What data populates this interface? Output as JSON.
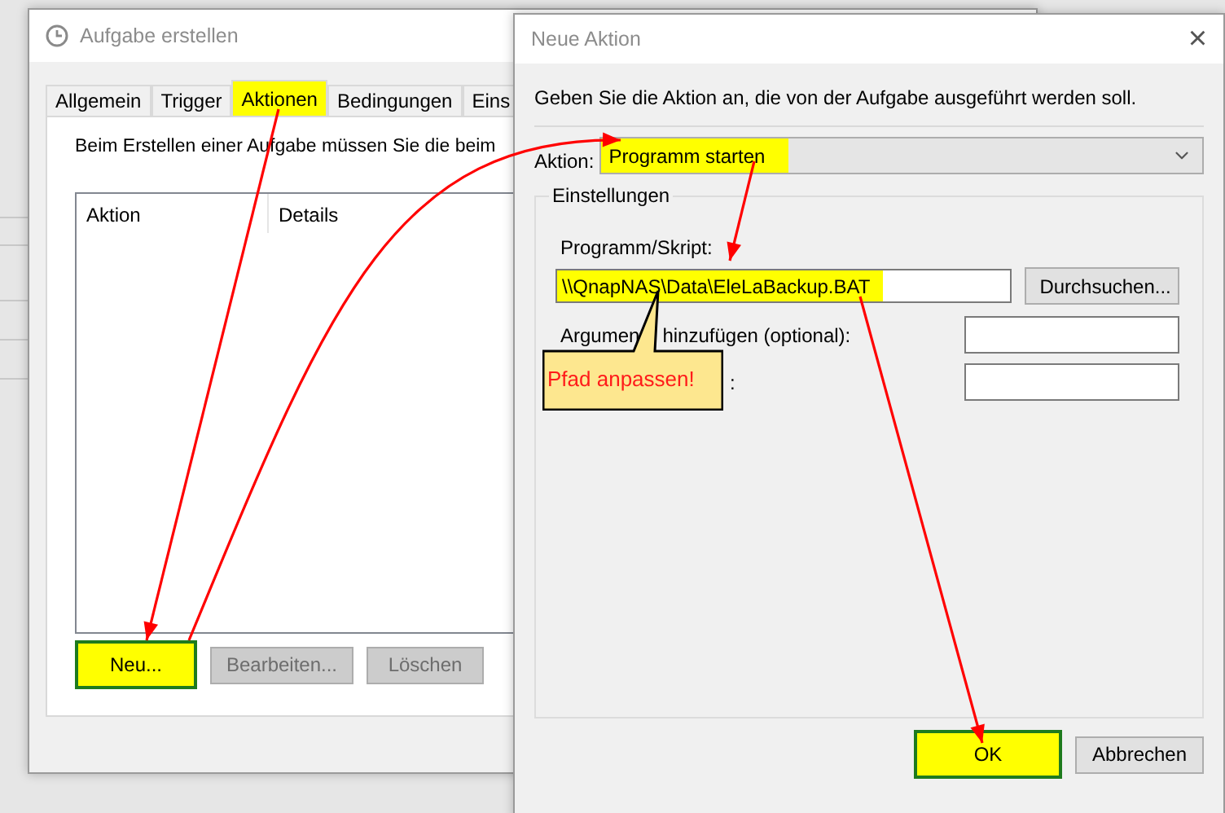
{
  "task_window": {
    "title": "Aufgabe erstellen",
    "tabs": [
      {
        "label": "Allgemein",
        "selected": false
      },
      {
        "label": "Trigger",
        "selected": false
      },
      {
        "label": "Aktionen",
        "selected": true
      },
      {
        "label": "Bedingungen",
        "selected": false
      },
      {
        "label": "Eins",
        "selected": false
      }
    ],
    "intro": "Beim Erstellen einer Aufgabe müssen Sie die beim",
    "table": {
      "columns": [
        "Aktion",
        "Details"
      ]
    },
    "buttons": [
      {
        "label": "Neu...",
        "disabled": false,
        "highlighted": true
      },
      {
        "label": "Bearbeiten...",
        "disabled": true,
        "highlighted": false
      },
      {
        "label": "Löschen",
        "disabled": true,
        "highlighted": false
      }
    ]
  },
  "action_dialog": {
    "title": "Neue Aktion",
    "close": "×",
    "instruction": "Geben Sie die Aktion an, die von der Aufgabe ausgeführt werden soll.",
    "action": {
      "label": "Aktion:",
      "value": "Programm starten",
      "highlighted": true
    },
    "group": {
      "title": "Einstellungen",
      "program": {
        "label": "Programm/Skript:",
        "value": "\\\\QnapNAS\\Data\\EleLaBackup.BAT",
        "highlighted": true,
        "browse": "Durchsuchen..."
      },
      "arguments": {
        "label_parts": [
          "Argumen",
          "hinzufügen (optional):"
        ]
      },
      "start_in": {
        "label": ":"
      }
    },
    "buttons": [
      {
        "label": "OK",
        "highlighted": true
      },
      {
        "label": "Abbrechen",
        "highlighted": false
      }
    ]
  },
  "callout": {
    "text": "Pfad anpassen!"
  }
}
